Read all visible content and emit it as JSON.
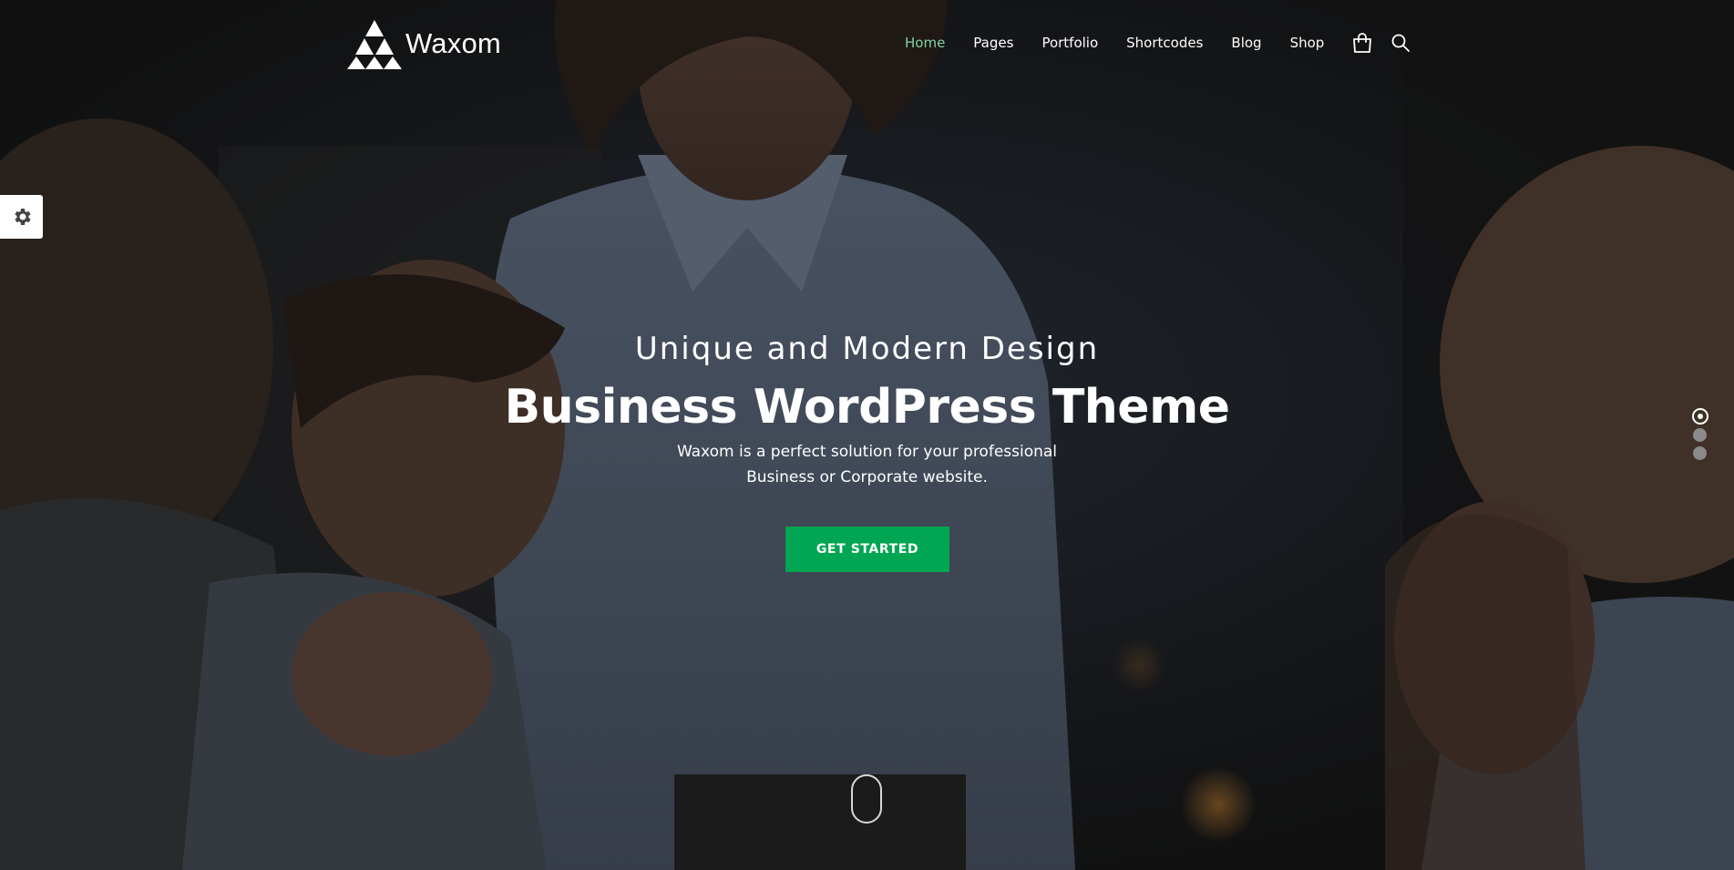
{
  "header": {
    "brand": "Waxom",
    "nav": [
      {
        "label": "Home",
        "active": true
      },
      {
        "label": "Pages",
        "active": false
      },
      {
        "label": "Portfolio",
        "active": false
      },
      {
        "label": "Shortcodes",
        "active": false
      },
      {
        "label": "Blog",
        "active": false
      },
      {
        "label": "Shop",
        "active": false
      }
    ],
    "icons": [
      "shopping-bag-icon",
      "search-icon"
    ]
  },
  "settings_tab": {
    "icon": "gear-icon"
  },
  "hero": {
    "subtitle": "Unique and Modern Design",
    "title": "Business WordPress Theme",
    "description_line1": "Waxom is a perfect solution for your professional",
    "description_line2": "Business or Corporate website.",
    "cta_label": "GET STARTED"
  },
  "slider": {
    "slides": 3,
    "active_index": 0
  },
  "colors": {
    "accent_green": "#00a651",
    "nav_active": "#7fd3a4",
    "text": "#ffffff"
  }
}
